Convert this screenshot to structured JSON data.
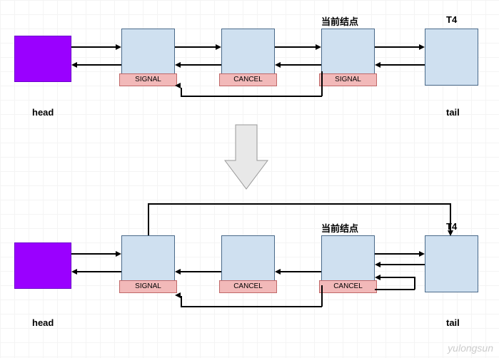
{
  "top": {
    "head_label": "head",
    "tail_label": "tail",
    "current_label": "当前结点",
    "t4_label": "T4",
    "statuses": [
      "SIGNAL",
      "CANCEL",
      "SIGNAL"
    ]
  },
  "bottom": {
    "head_label": "head",
    "tail_label": "tail",
    "current_label": "当前结点",
    "t4_label": "T4",
    "statuses": [
      "SIGNAL",
      "CANCEL",
      "CANCEL"
    ]
  },
  "watermark": "yulongsun"
}
